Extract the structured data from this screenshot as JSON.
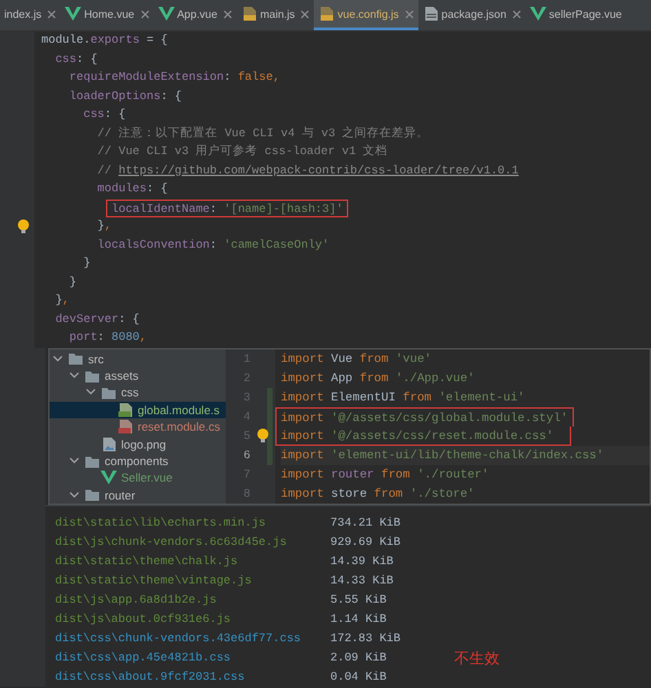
{
  "tabs": [
    {
      "label": "index.js",
      "selected": false,
      "close": true
    },
    {
      "label": "Home.vue",
      "kind": "vue",
      "selected": false,
      "close": true
    },
    {
      "label": "App.vue",
      "kind": "vue",
      "selected": false,
      "close": true
    },
    {
      "label": "main.js",
      "kind": "js",
      "selected": false,
      "close": true
    },
    {
      "label": "vue.config.js",
      "kind": "js",
      "selected": true,
      "close": true
    },
    {
      "label": "package.json",
      "kind": "json",
      "selected": false,
      "close": true
    },
    {
      "label": "sellerPage.vue",
      "kind": "vue",
      "selected": false,
      "close": false
    }
  ],
  "editor": {
    "lines": [
      {
        "tokens": [
          {
            "text": "module.",
            "kind": "plain"
          },
          {
            "text": "exports",
            "kind": "prop"
          },
          {
            "text": " = {",
            "kind": "plain"
          }
        ]
      },
      {
        "tokens": [
          {
            "text": "  css",
            "kind": "prop"
          },
          {
            "text": ": {",
            "kind": "plain"
          }
        ]
      },
      {
        "tokens": [
          {
            "text": "    requireModuleExtension",
            "kind": "prop"
          },
          {
            "text": ": ",
            "kind": "plain"
          },
          {
            "text": "false",
            "kind": "keyword"
          },
          {
            "text": ",",
            "kind": "keyword"
          }
        ]
      },
      {
        "tokens": [
          {
            "text": "    loaderOptions",
            "kind": "prop"
          },
          {
            "text": ": {",
            "kind": "plain"
          }
        ]
      },
      {
        "tokens": [
          {
            "text": "      css",
            "kind": "prop"
          },
          {
            "text": ": {",
            "kind": "plain"
          }
        ]
      },
      {
        "tokens": [
          {
            "text": "        // 注意：以下配置在 Vue CLI v4 与 v3 之间存在差异。",
            "kind": "comment"
          }
        ]
      },
      {
        "tokens": [
          {
            "text": "        // Vue CLI v3 用户可参考 css-loader v1 文档",
            "kind": "comment"
          }
        ]
      },
      {
        "tokens": [
          {
            "text": "        // ",
            "kind": "comment"
          },
          {
            "text": "https://github.com/webpack-contrib/css-loader/tree/v1.0.1",
            "kind": "link"
          }
        ]
      },
      {
        "tokens": [
          {
            "text": "        modules",
            "kind": "prop"
          },
          {
            "text": ": {",
            "kind": "plain"
          }
        ]
      },
      {
        "tokens": [
          {
            "text": "          localIdentName",
            "kind": "prop"
          },
          {
            "text": ": ",
            "kind": "plain"
          },
          {
            "text": "'[name]-[hash:3]'",
            "kind": "string"
          }
        ],
        "boxed": true
      },
      {
        "tokens": [
          {
            "text": "        }",
            "kind": "plain"
          },
          {
            "text": ",",
            "kind": "keyword"
          }
        ],
        "bulb": true
      },
      {
        "tokens": [
          {
            "text": "        localsConvention",
            "kind": "prop"
          },
          {
            "text": ": ",
            "kind": "plain"
          },
          {
            "text": "'camelCaseOnly'",
            "kind": "string"
          }
        ]
      },
      {
        "tokens": [
          {
            "text": "      }",
            "kind": "plain"
          }
        ]
      },
      {
        "tokens": [
          {
            "text": "    }",
            "kind": "plain"
          }
        ]
      },
      {
        "tokens": [
          {
            "text": "  }",
            "kind": "plain"
          },
          {
            "text": ",",
            "kind": "keyword"
          }
        ]
      },
      {
        "tokens": [
          {
            "text": "  devServer",
            "kind": "prop"
          },
          {
            "text": ": {",
            "kind": "plain"
          }
        ]
      },
      {
        "tokens": [
          {
            "text": "    port",
            "kind": "prop"
          },
          {
            "text": ": ",
            "kind": "plain"
          },
          {
            "text": "8080",
            "kind": "number"
          },
          {
            "text": ",",
            "kind": "keyword"
          }
        ]
      }
    ]
  },
  "project_tree": [
    {
      "label": "src",
      "kind": "folder",
      "expanded": true,
      "selected": false,
      "children": [
        {
          "label": "assets",
          "kind": "folder",
          "expanded": true,
          "selected": false,
          "children": [
            {
              "label": "css",
              "kind": "folder",
              "expanded": true,
              "selected": false,
              "children": [
                {
                  "label": "global.module.s",
                  "kind": "styl",
                  "selected": true
                },
                {
                  "label": "reset.module.cs",
                  "kind": "css",
                  "selected": false
                }
              ]
            },
            {
              "label": "logo.png",
              "kind": "image",
              "selected": false
            }
          ]
        },
        {
          "label": "components",
          "kind": "folder",
          "expanded": true,
          "selected": false,
          "children": [
            {
              "label": "Seller.vue",
              "kind": "vue",
              "selected": false
            }
          ]
        },
        {
          "label": "router",
          "kind": "folder",
          "expanded": true,
          "selected": false
        }
      ]
    }
  ],
  "main_js": {
    "lines": [
      {
        "number": "1",
        "tokens": [
          {
            "text": "import",
            "kind": "keyword"
          },
          {
            "text": " Vue ",
            "kind": "plain"
          },
          {
            "text": "from",
            "kind": "keyword"
          },
          {
            "text": " 'vue'",
            "kind": "string"
          }
        ]
      },
      {
        "number": "2",
        "tokens": [
          {
            "text": "import",
            "kind": "keyword"
          },
          {
            "text": " App ",
            "kind": "plain"
          },
          {
            "text": "from",
            "kind": "keyword"
          },
          {
            "text": " './App.vue'",
            "kind": "string"
          }
        ]
      },
      {
        "number": "3",
        "changed": true,
        "tokens": [
          {
            "text": "import",
            "kind": "keyword"
          },
          {
            "text": " ElementUI ",
            "kind": "plain"
          },
          {
            "text": "from",
            "kind": "keyword"
          },
          {
            "text": " 'element-ui'",
            "kind": "string"
          }
        ]
      },
      {
        "number": "4",
        "changed": true,
        "boxed": true,
        "tokens": [
          {
            "text": "import",
            "kind": "keyword"
          },
          {
            "text": " '@/assets/css/global.module.styl'",
            "kind": "string"
          }
        ]
      },
      {
        "number": "5",
        "changed": true,
        "boxed": true,
        "bulb": true,
        "tokens": [
          {
            "text": "import",
            "kind": "keyword"
          },
          {
            "text": " '@/assets/css/reset.module.css'",
            "kind": "string"
          }
        ]
      },
      {
        "number": "6",
        "changed": true,
        "current": true,
        "tokens": [
          {
            "text": "import",
            "kind": "keyword"
          },
          {
            "text": " 'element-ui/lib/theme-chalk/index.css'",
            "kind": "string"
          }
        ]
      },
      {
        "number": "7",
        "tokens": [
          {
            "text": "import",
            "kind": "keyword"
          },
          {
            "text": " router ",
            "kind": "prop"
          },
          {
            "text": "from",
            "kind": "keyword"
          },
          {
            "text": " './router'",
            "kind": "string"
          }
        ]
      },
      {
        "number": "8",
        "tokens": [
          {
            "text": "import",
            "kind": "keyword"
          },
          {
            "text": " store ",
            "kind": "plain"
          },
          {
            "text": "from",
            "kind": "keyword"
          },
          {
            "text": " './store'",
            "kind": "string"
          }
        ]
      }
    ]
  },
  "build_output": [
    {
      "path": "dist\\static\\lib\\echarts.min.js",
      "size": "734.21 KiB",
      "kind": "js"
    },
    {
      "path": "dist\\js\\chunk-vendors.6c63d45e.js",
      "size": "929.69 KiB",
      "kind": "js"
    },
    {
      "path": "dist\\static\\theme\\chalk.js",
      "size": "14.39 KiB",
      "kind": "js"
    },
    {
      "path": "dist\\static\\theme\\vintage.js",
      "size": "14.33 KiB",
      "kind": "js"
    },
    {
      "path": "dist\\js\\app.6a8d1b2e.js",
      "size": "5.55 KiB",
      "kind": "js"
    },
    {
      "path": "dist\\js\\about.0cf931e6.js",
      "size": "1.14 KiB",
      "kind": "js"
    },
    {
      "path": "dist\\css\\chunk-vendors.43e6df77.css",
      "size": "172.83 KiB",
      "kind": "css"
    },
    {
      "path": "dist\\css\\app.45e4821b.css",
      "size": "2.09 KiB",
      "kind": "css",
      "note": "不生效"
    },
    {
      "path": "dist\\css\\about.9fcf2031.css",
      "size": "0.04 KiB",
      "kind": "css"
    }
  ]
}
